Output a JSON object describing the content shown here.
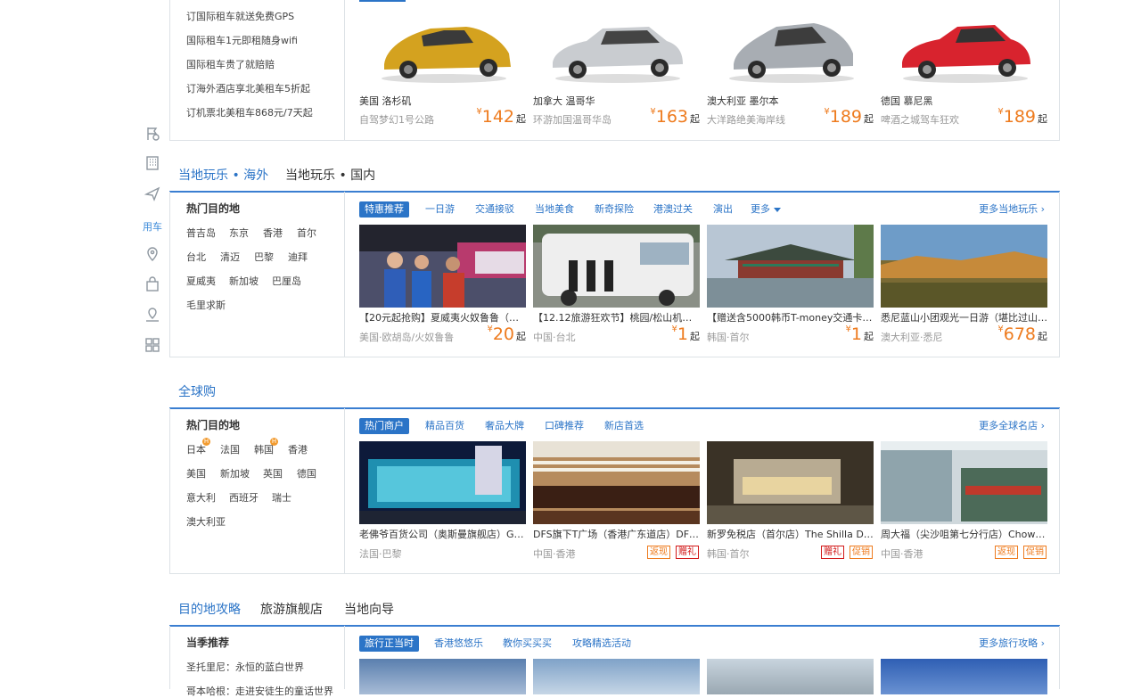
{
  "sidebar_rail": {
    "items": [
      {
        "icon": "flag-icon"
      },
      {
        "icon": "hotel-building-icon"
      },
      {
        "icon": "plane-icon"
      },
      {
        "label": "用车"
      },
      {
        "icon": "location-pin-icon"
      },
      {
        "icon": "shopping-bag-icon"
      },
      {
        "icon": "map-pin-icon"
      },
      {
        "icon": "apps-grid-icon"
      }
    ]
  },
  "car_rental": {
    "links": [
      "订国际租车就送免费GPS",
      "国际租车1元即租随身wifi",
      "国际租车贵了就赔赔",
      "订海外酒店享北美租车5折起",
      "订机票北美租车868元/7天起"
    ],
    "cars": [
      {
        "location": "美国 洛杉矶",
        "desc": "自驾梦幻1号公路",
        "price": "142",
        "color": "#d4a21f"
      },
      {
        "location": "加拿大 温哥华",
        "desc": "环游加国温哥华岛",
        "price": "163",
        "color": "#c9ccd0"
      },
      {
        "location": "澳大利亚 墨尔本",
        "desc": "大洋路绝美海岸线",
        "price": "189",
        "color": "#a8adb3"
      },
      {
        "location": "德国 慕尼黑",
        "desc": "啤酒之城驾车狂欢",
        "price": "189",
        "color": "#d8232e"
      }
    ],
    "currency": "¥",
    "qi": "起"
  },
  "local_fun": {
    "tabs": [
      "当地玩乐 • 海外",
      "当地玩乐 • 国内"
    ],
    "hot_title": "热门目的地",
    "destinations": [
      "普吉岛",
      "东京",
      "香港",
      "首尔",
      "台北",
      "清迈",
      "巴黎",
      "迪拜",
      "夏威夷",
      "新加坡",
      "巴厘岛",
      "毛里求斯"
    ],
    "subtabs": [
      "特惠推荐",
      "一日游",
      "交通接驳",
      "当地美食",
      "新奇探险",
      "港澳过关",
      "演出",
      "更多"
    ],
    "more_link": "更多当地玩乐",
    "cards": [
      {
        "name": "【20元起抢购】夏威夷火奴鲁鲁（檀香...",
        "loc": "美国·欧胡岛/火奴鲁鲁",
        "price": "20"
      },
      {
        "name": "【12.12旅游狂欢节】桃园/松山机场至...",
        "loc": "中国·台北",
        "price": "1"
      },
      {
        "name": "【赠送含5000韩币T-money交通卡】...",
        "loc": "韩国·首尔",
        "price": "1"
      },
      {
        "name": "悉尼蓝山小团观光一日游（堪比过山车...",
        "loc": "澳大利亚·悉尼",
        "price": "678"
      }
    ]
  },
  "global_shopping": {
    "tab": "全球购",
    "hot_title": "热门目的地",
    "destinations": [
      "日本",
      "法国",
      "韩国",
      "香港",
      "美国",
      "新加坡",
      "英国",
      "德国",
      "意大利",
      "西班牙",
      "瑞士",
      "澳大利亚"
    ],
    "badge": "H",
    "subtabs": [
      "热门商户",
      "精品百货",
      "奢品大牌",
      "口碑推荐",
      "新店首选"
    ],
    "more_link": "更多全球名店",
    "cards": [
      {
        "name": "老佛爷百货公司（奥斯曼旗舰店）Gale...",
        "loc": "法国·巴黎",
        "tags": []
      },
      {
        "name": "DFS旗下T广场（香港广东道店）DFS ...",
        "loc": "中国·香港",
        "tags": [
          "返现",
          "赠礼"
        ]
      },
      {
        "name": "新罗免税店（首尔店）The Shilla Duty ...",
        "loc": "韩国·首尔",
        "tags": [
          "赠礼",
          "促销"
        ]
      },
      {
        "name": "周大福（尖沙咀第七分行店）Chow Ta...",
        "loc": "中国·香港",
        "tags": [
          "返现",
          "促销"
        ]
      }
    ]
  },
  "guides": {
    "tabs": [
      "目的地攻略",
      "旅游旗舰店",
      "当地向导"
    ],
    "left_title": "当季推荐",
    "left_items": [
      "圣托里尼：永恒的蓝白世界",
      "哥本哈根：走进安徒生的童话世界"
    ],
    "subtabs": [
      "旅行正当时",
      "香港悠悠乐",
      "教你买买买",
      "攻略精选活动"
    ],
    "more_link": "更多旅行攻略"
  }
}
